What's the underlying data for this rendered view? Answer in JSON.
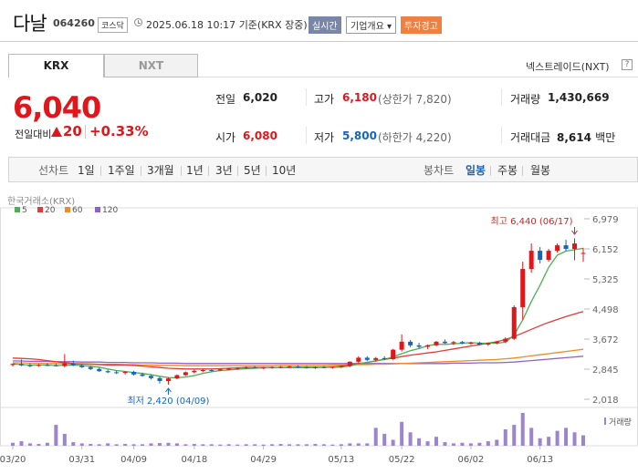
{
  "header": {
    "name": "다날",
    "code": "064260",
    "market": "코스닥",
    "datetime": "2025.06.18 10:17",
    "basis": "기준(KRX 장중)",
    "live_label": "실시간",
    "company_label": "기업개요",
    "company_caret": "▾",
    "warning_label": "투자경고"
  },
  "tabs": {
    "krx": "KRX",
    "nxt": "NXT",
    "nxt_title": "넥스트레이드(NXT)",
    "help": "?"
  },
  "quote": {
    "price": "6,040",
    "change_label": "전일대비",
    "change": "20",
    "change_pct": "+0.33%",
    "stats": {
      "prev_label": "전일",
      "prev": "6,020",
      "high_label": "고가",
      "high": "6,180",
      "upper_limit": "(상한가 7,820)",
      "volume_label": "거래량",
      "volume": "1,430,669",
      "open_label": "시가",
      "open": "6,080",
      "low_label": "저가",
      "low": "5,800",
      "lower_limit": "(하한가 4,220)",
      "amount_label": "거래대금",
      "amount": "8,614",
      "amount_unit": "백만"
    }
  },
  "period": {
    "line_label": "선차트",
    "line_items": [
      "1일",
      "1주일",
      "3개월",
      "1년",
      "3년",
      "5년",
      "10년"
    ],
    "candle_label": "봉차트",
    "candle_items": [
      "일봉",
      "주봉",
      "월봉"
    ],
    "candle_selected": 0
  },
  "colors": {
    "up": "#e0161b",
    "down": "#1565c0",
    "ma5": "#4caf50",
    "ma20": "#e53935",
    "ma60": "#f08a24",
    "ma120": "#8e63c7",
    "volume": "#9c85cc"
  },
  "chart_data": {
    "type": "candlestick",
    "source": "한국거래소(KRX)",
    "legend": [
      "5",
      "20",
      "60",
      "120"
    ],
    "y_ticks": [
      "6,979",
      "6,152",
      "5,325",
      "4,498",
      "3,672",
      "2,845",
      "2,018"
    ],
    "ylim": [
      2018,
      6979
    ],
    "x_ticks": [
      "03/20",
      "03/31",
      "04/09",
      "04/18",
      "04/29",
      "05/13",
      "05/22",
      "06/02",
      "06/13"
    ],
    "volume_label": "거래량",
    "annotations": {
      "high": "최고 6,440 (06/17)",
      "low": "최저 2,420 (04/09)"
    },
    "candles": [
      [
        2960,
        3000,
        2920,
        2990
      ],
      [
        2990,
        3110,
        2930,
        2950
      ],
      [
        2950,
        3000,
        2900,
        2940
      ],
      [
        2940,
        2990,
        2910,
        2960
      ],
      [
        2960,
        3010,
        2930,
        2950
      ],
      [
        2950,
        3000,
        2920,
        2930
      ],
      [
        2930,
        3260,
        2900,
        3000
      ],
      [
        3000,
        3080,
        2930,
        2950
      ],
      [
        2950,
        3000,
        2880,
        2900
      ],
      [
        2900,
        2940,
        2820,
        2850
      ],
      [
        2850,
        2890,
        2770,
        2790
      ],
      [
        2790,
        2830,
        2740,
        2760
      ],
      [
        2760,
        2800,
        2710,
        2740
      ],
      [
        2740,
        2790,
        2700,
        2770
      ],
      [
        2770,
        2800,
        2670,
        2700
      ],
      [
        2700,
        2750,
        2640,
        2660
      ],
      [
        2660,
        2700,
        2560,
        2600
      ],
      [
        2600,
        2640,
        2450,
        2520
      ],
      [
        2520,
        2620,
        2420,
        2590
      ],
      [
        2590,
        2700,
        2570,
        2680
      ],
      [
        2680,
        2780,
        2660,
        2760
      ],
      [
        2760,
        2830,
        2730,
        2800
      ],
      [
        2800,
        2850,
        2760,
        2820
      ],
      [
        2820,
        2850,
        2780,
        2810
      ],
      [
        2810,
        2860,
        2790,
        2840
      ],
      [
        2840,
        2880,
        2810,
        2860
      ],
      [
        2860,
        2900,
        2830,
        2880
      ],
      [
        2880,
        2920,
        2850,
        2900
      ],
      [
        2900,
        2930,
        2860,
        2870
      ],
      [
        2870,
        2910,
        2850,
        2890
      ],
      [
        2890,
        2920,
        2860,
        2900
      ],
      [
        2900,
        2930,
        2870,
        2910
      ],
      [
        2910,
        2940,
        2880,
        2920
      ],
      [
        2920,
        2950,
        2880,
        2900
      ],
      [
        2900,
        2930,
        2860,
        2880
      ],
      [
        2880,
        2920,
        2850,
        2900
      ],
      [
        2900,
        2930,
        2870,
        2890
      ],
      [
        2890,
        2920,
        2860,
        2910
      ],
      [
        2910,
        2950,
        2880,
        2930
      ],
      [
        2930,
        3060,
        2900,
        3050
      ],
      [
        3050,
        3200,
        3000,
        3160
      ],
      [
        3160,
        3200,
        3060,
        3100
      ],
      [
        3100,
        3180,
        3050,
        3150
      ],
      [
        3150,
        3200,
        3100,
        3120
      ],
      [
        3120,
        3400,
        3100,
        3380
      ],
      [
        3380,
        3800,
        3330,
        3600
      ],
      [
        3600,
        3650,
        3450,
        3500
      ],
      [
        3500,
        3570,
        3420,
        3460
      ],
      [
        3460,
        3520,
        3400,
        3500
      ],
      [
        3500,
        3620,
        3480,
        3600
      ],
      [
        3600,
        3660,
        3540,
        3560
      ],
      [
        3560,
        3620,
        3510,
        3590
      ],
      [
        3590,
        3620,
        3530,
        3550
      ],
      [
        3550,
        3600,
        3510,
        3570
      ],
      [
        3570,
        3600,
        3500,
        3520
      ],
      [
        3520,
        3580,
        3490,
        3560
      ],
      [
        3560,
        3620,
        3530,
        3600
      ],
      [
        3600,
        3720,
        3560,
        3680
      ],
      [
        3680,
        4600,
        3650,
        4550
      ],
      [
        4550,
        5800,
        4200,
        5600
      ],
      [
        5600,
        6300,
        5500,
        6100
      ],
      [
        6100,
        6200,
        5750,
        5850
      ],
      [
        5850,
        6150,
        5800,
        6100
      ],
      [
        6100,
        6300,
        6050,
        6250
      ],
      [
        6250,
        6400,
        6100,
        6150
      ],
      [
        6150,
        6440,
        5840,
        6300
      ],
      [
        6020,
        6180,
        5800,
        6040
      ]
    ],
    "ma20": [
      3150,
      3140,
      3130,
      3110,
      3080,
      3050,
      3020,
      3000,
      2990,
      2980,
      2970,
      2960,
      2960,
      2960,
      2950,
      2930,
      2910,
      2890,
      2870,
      2860,
      2850,
      2850,
      2850,
      2850,
      2860,
      2870,
      2880,
      2890,
      2890,
      2890,
      2890,
      2890,
      2890,
      2890,
      2890,
      2890,
      2900,
      2910,
      2930,
      2960,
      3000,
      3030,
      3070,
      3110,
      3150,
      3190,
      3230,
      3260,
      3290,
      3320,
      3360,
      3400,
      3440,
      3480,
      3520,
      3560,
      3600,
      3660,
      3740,
      3840,
      3940,
      4040,
      4130,
      4210,
      4290,
      4360,
      4430
    ],
    "ma60": [
      3020,
      3020,
      3010,
      3010,
      3000,
      3000,
      3000,
      2990,
      2990,
      2990,
      2980,
      2980,
      2980,
      2970,
      2970,
      2960,
      2960,
      2950,
      2950,
      2950,
      2940,
      2940,
      2940,
      2940,
      2940,
      2940,
      2940,
      2940,
      2940,
      2940,
      2940,
      2950,
      2950,
      2950,
      2950,
      2950,
      2950,
      2960,
      2960,
      2960,
      2970,
      2970,
      2980,
      2980,
      2990,
      3000,
      3010,
      3020,
      3030,
      3040,
      3050,
      3060,
      3070,
      3080,
      3090,
      3100,
      3110,
      3130,
      3150,
      3180,
      3210,
      3240,
      3270,
      3300,
      3330,
      3360,
      3390
    ],
    "ma120": [
      3070,
      3070,
      3060,
      3060,
      3060,
      3050,
      3050,
      3050,
      3040,
      3040,
      3040,
      3030,
      3030,
      3030,
      3020,
      3020,
      3020,
      3010,
      3010,
      3010,
      3000,
      3000,
      3000,
      3000,
      3000,
      3000,
      3000,
      3000,
      3000,
      3000,
      3000,
      3000,
      3000,
      3000,
      3000,
      3000,
      3000,
      3000,
      3000,
      3000,
      3000,
      3000,
      3000,
      3000,
      3000,
      3000,
      3000,
      3000,
      3000,
      3000,
      3000,
      3010,
      3010,
      3010,
      3020,
      3020,
      3020,
      3030,
      3040,
      3060,
      3080,
      3100,
      3120,
      3140,
      3160,
      3180,
      3200
    ],
    "volume": [
      10,
      15,
      8,
      6,
      10,
      70,
      40,
      12,
      8,
      6,
      5,
      8,
      5,
      6,
      5,
      5,
      8,
      9,
      10,
      8,
      5,
      6,
      5,
      5,
      4,
      5,
      4,
      5,
      5,
      4,
      5,
      6,
      5,
      5,
      5,
      6,
      5,
      4,
      5,
      8,
      8,
      8,
      60,
      40,
      20,
      80,
      45,
      25,
      15,
      30,
      12,
      8,
      10,
      8,
      10,
      15,
      20,
      55,
      70,
      110,
      60,
      25,
      30,
      50,
      60,
      45,
      35
    ]
  }
}
